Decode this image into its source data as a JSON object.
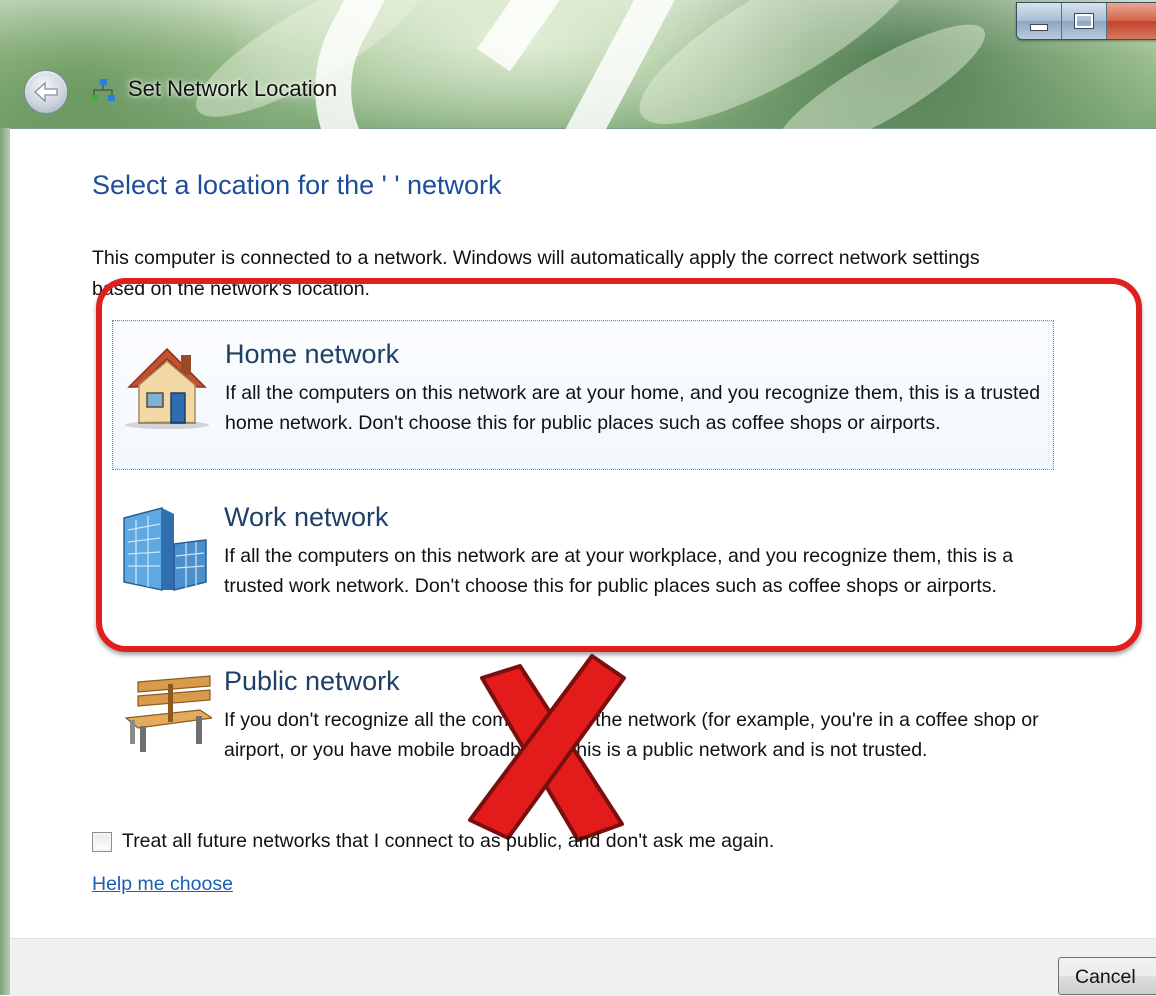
{
  "window": {
    "title": "Set Network Location",
    "controls": [
      "minimize",
      "maximize",
      "close"
    ]
  },
  "page": {
    "heading": "Select a location for the '           ' network",
    "intro": "This computer is connected to a network. Windows will automatically apply the correct network settings based on the network's location."
  },
  "options": [
    {
      "title": "Home network",
      "description": "If all the computers on this network are at your home, and you recognize them, this is a trusted home network.  Don't choose this for public places such as coffee shops or airports.",
      "icon": "house-icon",
      "focused": true
    },
    {
      "title": "Work network",
      "description": "If all the computers on this network are at your workplace, and you recognize them, this is a trusted work network.  Don't choose this for public places such as coffee shops or airports.",
      "icon": "office-building-icon",
      "focused": false
    },
    {
      "title": "Public network",
      "description": "If you don't recognize all the computers on the network (for example, you're in a coffee shop or airport, or you have mobile broadband), this is a public network and is not trusted.",
      "icon": "park-bench-icon",
      "focused": false
    }
  ],
  "checkbox": {
    "label": "Treat all future networks that I connect to as public, and don't ask me again.",
    "checked": false
  },
  "help_link": "Help me choose",
  "footer": {
    "cancel_label": "Cancel"
  },
  "annotations": {
    "highlight_color": "#e01f1f",
    "recommended": [
      "Home network",
      "Work network"
    ],
    "rejected": "Public network"
  }
}
